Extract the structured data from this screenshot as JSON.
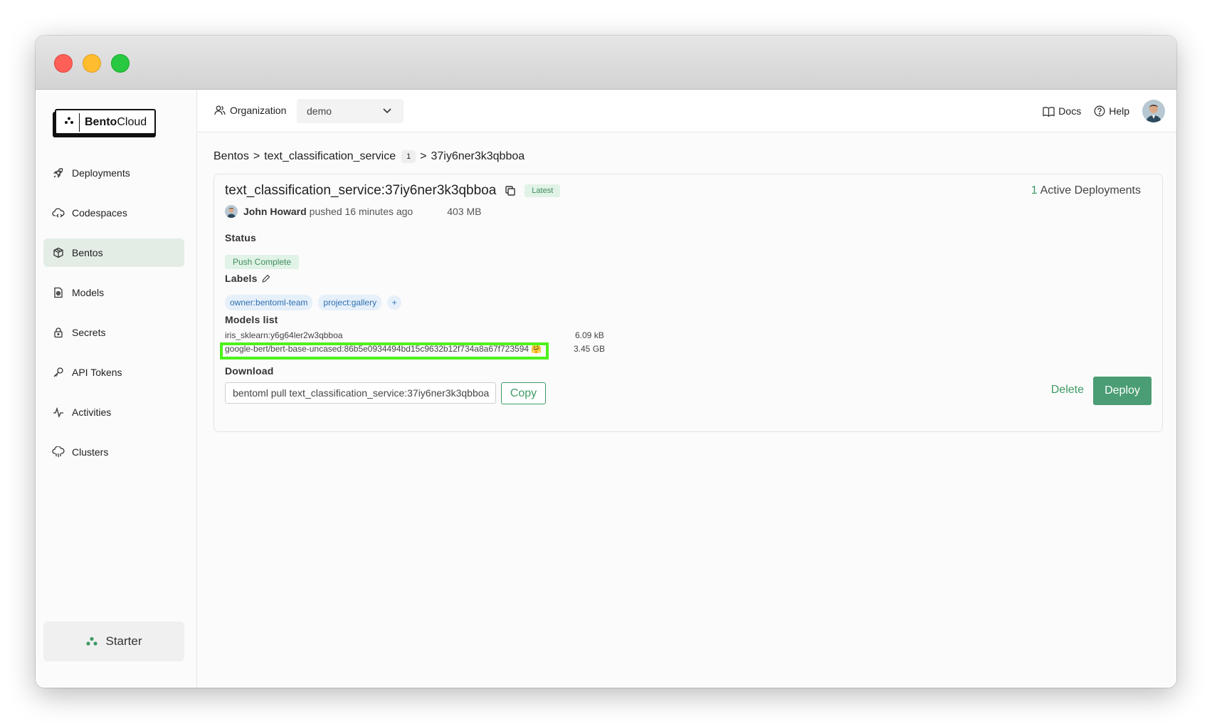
{
  "brand": {
    "name_bold": "Bento",
    "name_rest": "Cloud"
  },
  "sidebar": {
    "items": [
      {
        "label": "Deployments",
        "icon": "rocket-icon"
      },
      {
        "label": "Codespaces",
        "icon": "cloud-code-icon"
      },
      {
        "label": "Bentos",
        "icon": "box-icon",
        "active": true
      },
      {
        "label": "Models",
        "icon": "model-file-icon"
      },
      {
        "label": "Secrets",
        "icon": "lock-icon"
      },
      {
        "label": "API Tokens",
        "icon": "key-icon"
      },
      {
        "label": "Activities",
        "icon": "activity-icon"
      },
      {
        "label": "Clusters",
        "icon": "cluster-cloud-icon"
      }
    ],
    "plan": "Starter"
  },
  "topbar": {
    "org_label": "Organization",
    "org_value": "demo",
    "docs": "Docs",
    "help": "Help"
  },
  "breadcrumb": {
    "root": "Bentos",
    "sep": ">",
    "service": "text_classification_service",
    "count": "1",
    "version": "37iy6ner3k3qbboa"
  },
  "bento": {
    "name": "text_classification_service",
    "colon": ":",
    "version": "37iy6ner3k3qbboa",
    "latest_badge": "Latest",
    "active_count": "1",
    "active_label": "Active Deployments",
    "author": "John Howard",
    "pushed_text": "pushed 16 minutes ago",
    "size": "403 MB",
    "status_title": "Status",
    "status": "Push Complete",
    "labels_title": "Labels",
    "labels": [
      "owner:bentoml-team",
      "project:gallery"
    ],
    "label_add": "+",
    "models_title": "Models list",
    "models": [
      {
        "tag": "iris_sklearn:y6g64ler2w3qbboa",
        "size": "6.09 kB"
      },
      {
        "tag": "google-bert/bert-base-uncased:86b5e0934494bd15c9632b12f734a8a67f723594 🤗",
        "size": "3.45 GB"
      }
    ],
    "download_title": "Download",
    "download_cmd": "bentoml pull text_classification_service:37iy6ner3k3qbboa",
    "copy_label": "Copy",
    "delete_label": "Delete",
    "deploy_label": "Deploy"
  },
  "colors": {
    "accent": "#4a9d74",
    "highlight": "#4ef21b",
    "active_nav": "#e3ede6"
  }
}
